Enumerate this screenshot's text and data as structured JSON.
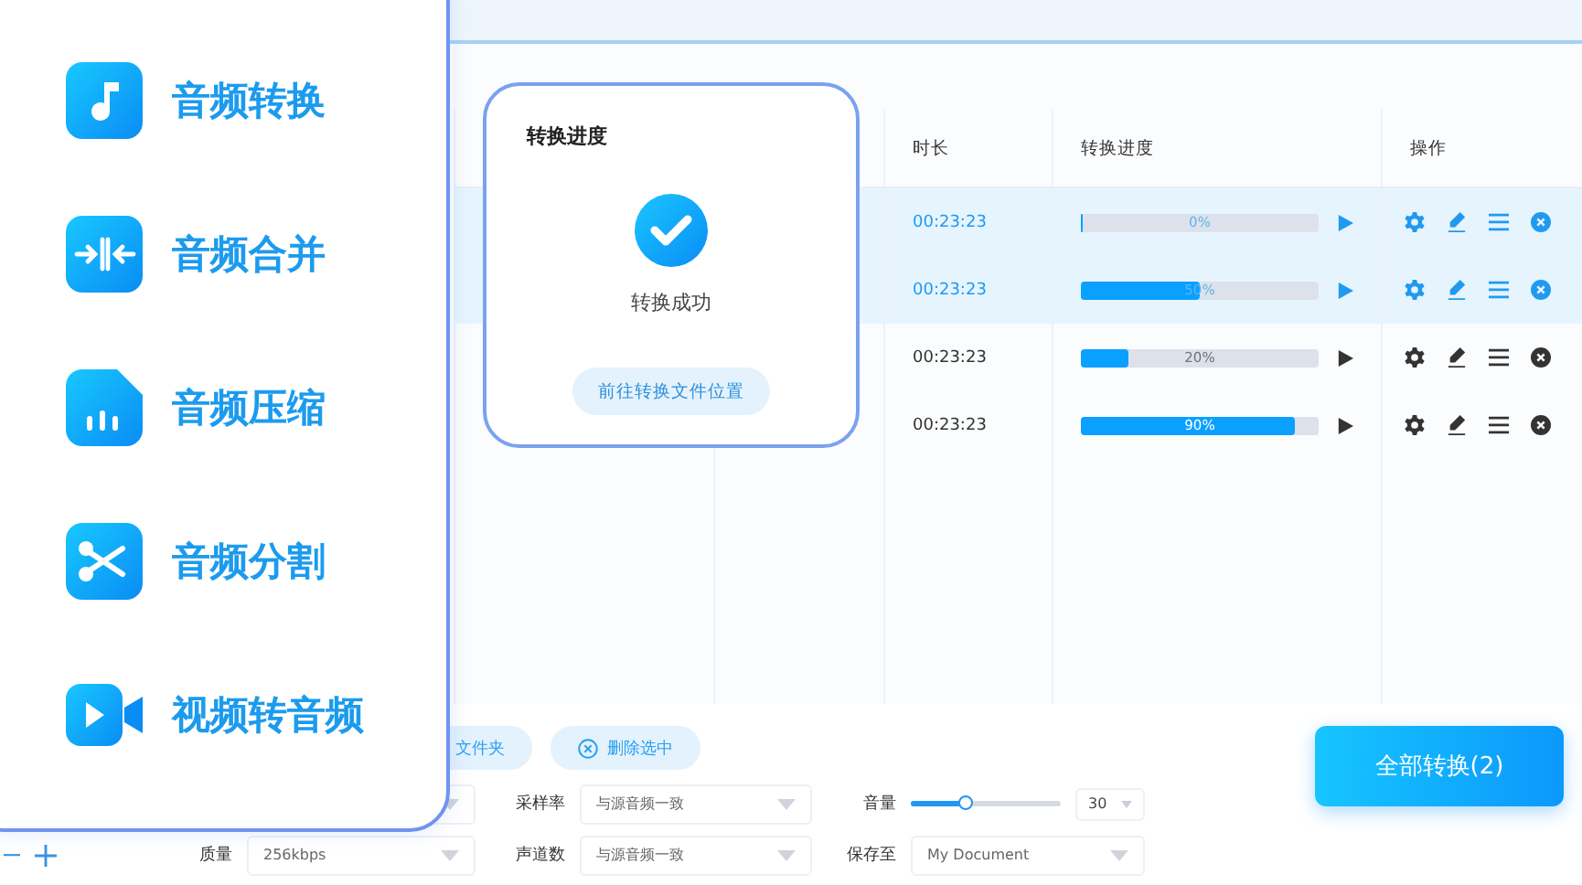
{
  "feature_menu": {
    "items": [
      {
        "label": "音频转换",
        "kind": "note"
      },
      {
        "label": "音频合并",
        "kind": "merge"
      },
      {
        "label": "音频压缩",
        "kind": "compress"
      },
      {
        "label": "音频分割",
        "kind": "split"
      },
      {
        "label": "视频转音频",
        "kind": "video"
      }
    ]
  },
  "progress_dialog": {
    "title": "转换进度",
    "status": "转换成功",
    "button": "前往转换文件位置"
  },
  "table": {
    "columns": [
      "时长",
      "转换进度",
      "操作"
    ],
    "rows": [
      {
        "duration": "00:23:23",
        "progress": "0%",
        "level": 0,
        "selected": true
      },
      {
        "duration": "00:23:23",
        "progress": "50%",
        "level": 0.5,
        "selected": true
      },
      {
        "duration": "00:23:23",
        "progress": "20%",
        "level": 0.2,
        "selected": false
      },
      {
        "duration": "00:23:23",
        "progress": "90%",
        "level": 0.9,
        "selected": false
      }
    ]
  },
  "toolbar": [
    {
      "label": "文件夹",
      "kind": "folder"
    },
    {
      "label": "删除选中",
      "kind": "delete"
    }
  ],
  "settings": {
    "sample_rate": {
      "label": "采样率",
      "value": "与源音频一致"
    },
    "volume": {
      "label": "音量",
      "level": 0.37,
      "value": "30"
    },
    "quality": {
      "label": "质量",
      "value": "256kbps"
    },
    "channels": {
      "label": "声道数",
      "value": "与源音频一致"
    },
    "save_to": {
      "label": "保存至",
      "value": "My Document"
    }
  },
  "convert_all_button": "全部转换(2)"
}
